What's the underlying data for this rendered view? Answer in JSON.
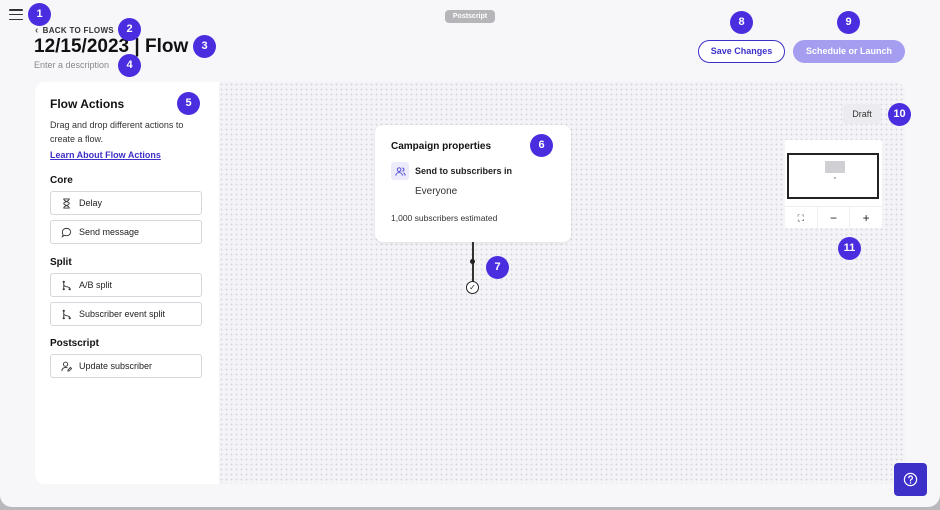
{
  "header": {
    "brand": "Postscript",
    "back_label": "BACK TO FLOWS",
    "title": "12/15/2023 | Flow",
    "description_placeholder": "Enter a description",
    "save_label": "Save Changes",
    "launch_label": "Schedule or Launch"
  },
  "sidebar": {
    "title": "Flow Actions",
    "description": "Drag and drop different actions to create a flow.",
    "learn_link": "Learn About Flow Actions",
    "sections": {
      "core": {
        "title": "Core",
        "items": [
          {
            "label": "Delay",
            "icon": "hourglass-icon"
          },
          {
            "label": "Send message",
            "icon": "chat-bubble-icon"
          }
        ]
      },
      "split": {
        "title": "Split",
        "items": [
          {
            "label": "A/B split",
            "icon": "branch-icon"
          },
          {
            "label": "Subscriber event split",
            "icon": "branch-icon"
          }
        ]
      },
      "postscript": {
        "title": "Postscript",
        "items": [
          {
            "label": "Update subscriber",
            "icon": "user-edit-icon"
          }
        ]
      }
    }
  },
  "canvas": {
    "status_badge": "Draft",
    "trigger_card": {
      "title": "Campaign properties",
      "subtitle": "Send to subscribers in",
      "audience": "Everyone",
      "estimate": "1,000 subscribers estimated"
    },
    "end_node_symbol": "✓",
    "minimap_controls": {
      "fit": "⛶",
      "zoom_out": "−",
      "zoom_in": "+"
    }
  },
  "markers": [
    "1",
    "2",
    "3",
    "4",
    "5",
    "6",
    "7",
    "8",
    "9",
    "10",
    "11"
  ],
  "colors": {
    "accent": "#3d30c9",
    "accent_disabled": "#a49df0",
    "marker": "#4b2de0"
  }
}
